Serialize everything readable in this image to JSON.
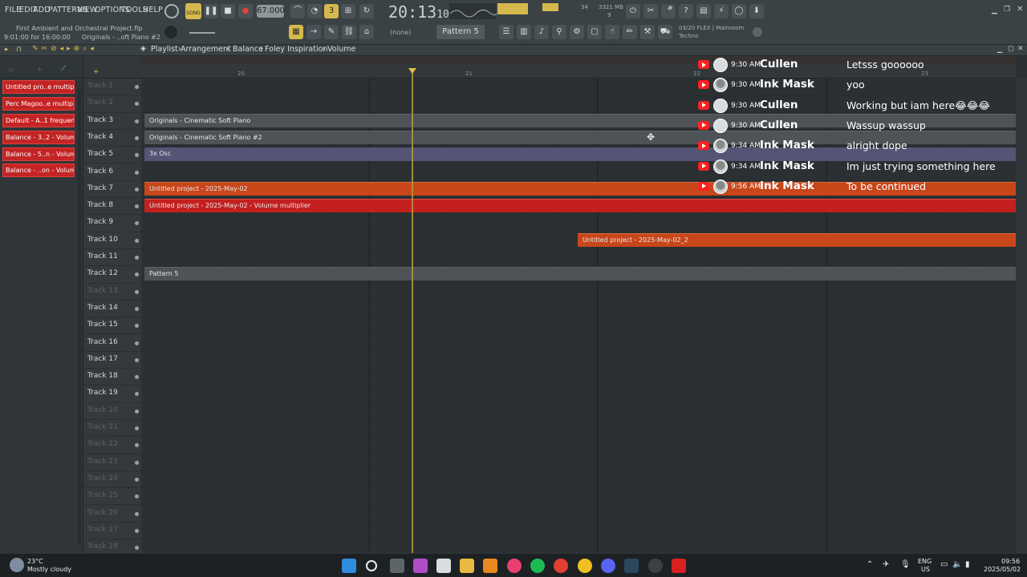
{
  "menu": [
    "FILE",
    "EDIT",
    "ADD",
    "PATTERNS",
    "VIEW",
    "OPTIONS",
    "TOOLS",
    "HELP"
  ],
  "project": {
    "file": "First Ambient and Orchestral Project.flp",
    "time": "9:01:00 for 16:00:00",
    "hint": "Originals - ..oft Piano #2"
  },
  "transport": {
    "tempo": "67.000",
    "clock": "20:13",
    "clock_sub": "10",
    "song_label": "SONG",
    "cpu": "34",
    "memory": "3321 MB",
    "voices": "9",
    "pattern": "Pattern 5",
    "snap": "(none)",
    "news_line1": "03/20 FLEX | Mainroom",
    "news_line2": "Techno"
  },
  "breadcrumb": [
    "Playlist",
    "Arrangement",
    "Balance",
    "Foley Inspiration",
    "Volume"
  ],
  "left_clips": [
    "Untitled pro..e multiplier",
    "Perc Magoo..e multiplier",
    "Default - A..1 frequency",
    "Balance - 3..2 - Volume",
    "Balance - 5..n - Volume",
    "Balance - ..on - Volume"
  ],
  "ruler": [
    "20",
    "21",
    "22",
    "23"
  ],
  "tracks": [
    {
      "name": "Track 1",
      "dim": true
    },
    {
      "name": "Track 2",
      "dim": true
    },
    {
      "name": "Track 3",
      "dim": false
    },
    {
      "name": "Track 4",
      "dim": false
    },
    {
      "name": "Track 5",
      "dim": false
    },
    {
      "name": "Track 6",
      "dim": false
    },
    {
      "name": "Track 7",
      "dim": false
    },
    {
      "name": "Track 8",
      "dim": false
    },
    {
      "name": "Track 9",
      "dim": false
    },
    {
      "name": "Track 10",
      "dim": false
    },
    {
      "name": "Track 11",
      "dim": false
    },
    {
      "name": "Track 12",
      "dim": false
    },
    {
      "name": "Track 13",
      "dim": true
    },
    {
      "name": "Track 14",
      "dim": false
    },
    {
      "name": "Track 15",
      "dim": false
    },
    {
      "name": "Track 16",
      "dim": false
    },
    {
      "name": "Track 17",
      "dim": false
    },
    {
      "name": "Track 18",
      "dim": false
    },
    {
      "name": "Track 19",
      "dim": false
    },
    {
      "name": "Track 20",
      "dim": true
    },
    {
      "name": "Track 21",
      "dim": true
    },
    {
      "name": "Track 22",
      "dim": true
    },
    {
      "name": "Track 23",
      "dim": true
    },
    {
      "name": "Track 24",
      "dim": true
    },
    {
      "name": "Track 25",
      "dim": true
    },
    {
      "name": "Track 26",
      "dim": true
    },
    {
      "name": "Track 27",
      "dim": true
    },
    {
      "name": "Track 28",
      "dim": true
    }
  ],
  "clips": {
    "t3": "Originals - Cinematic Soft Piano",
    "t4": "Originals - Cinematic Soft Piano #2",
    "t5": "3x Osc",
    "t7": "Untitled project - 2025-May-02",
    "t8": "Untitled project - 2025-May-02 - Volume multiplier",
    "t10": "Untitled project - 2025-May-02_2",
    "t12": "Pattern 5"
  },
  "chat": [
    {
      "time": "9:30 AM",
      "user": "Cullen",
      "msg": "Letsss goooooo"
    },
    {
      "time": "9:30 AM",
      "user": "Ink Mask",
      "msg": "yoo"
    },
    {
      "time": "9:30 AM",
      "user": "Cullen",
      "msg": "Working but iam here😂😂😂"
    },
    {
      "time": "9:30 AM",
      "user": "Cullen",
      "msg": "Wassup wassup"
    },
    {
      "time": "9:34 AM",
      "user": "Ink Mask",
      "msg": "alright dope"
    },
    {
      "time": "9:34 AM",
      "user": "Ink Mask",
      "msg": "Im just trying something here"
    },
    {
      "time": "9:56 AM",
      "user": "Ink Mask",
      "msg": "To be continued"
    }
  ],
  "taskbar": {
    "weather_temp": "23°C",
    "weather_desc": "Mostly cloudy",
    "lang": "ENG",
    "region": "US",
    "time": "09:56",
    "date": "2025/05/02"
  },
  "colors": {
    "accent_yellow": "#d6b94c",
    "clip_orange": "#c8461a",
    "clip_red": "#c41f1f",
    "youtube_red": "#ff2020"
  }
}
